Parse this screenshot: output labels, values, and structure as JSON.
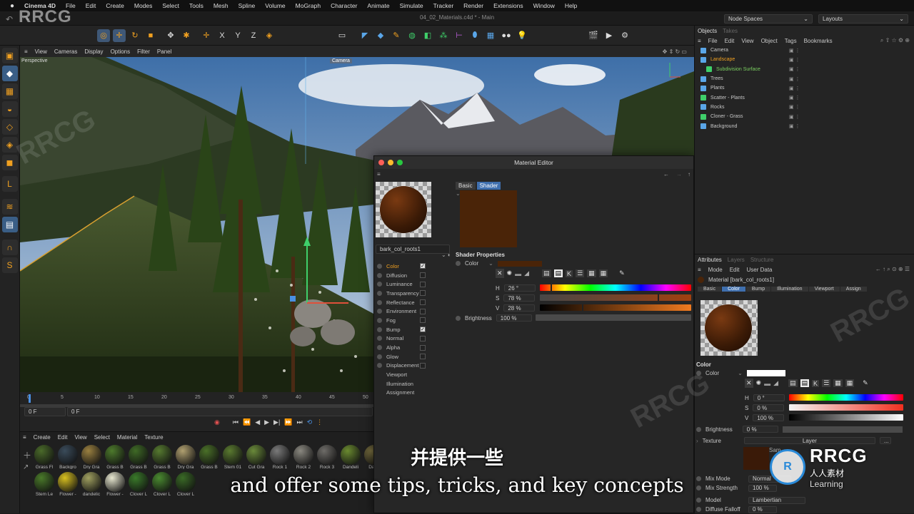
{
  "menubar": {
    "app": "Cinema 4D",
    "items": [
      "File",
      "Edit",
      "Create",
      "Modes",
      "Select",
      "Tools",
      "Mesh",
      "Spline",
      "Volume",
      "MoGraph",
      "Character",
      "Animate",
      "Simulate",
      "Tracker",
      "Render",
      "Extensions",
      "Window",
      "Help"
    ]
  },
  "watermark_top": "RRCG",
  "document_title": "04_02_Materials.c4d * - Main",
  "node_spaces": "Node Spaces",
  "layouts": "Layouts",
  "viewport": {
    "menu": [
      "View",
      "Cameras",
      "Display",
      "Options",
      "Filter",
      "Panel"
    ],
    "label": "Perspective",
    "camera_tag": "Camera"
  },
  "timeline": {
    "ticks": [
      "0",
      "5",
      "10",
      "15",
      "20",
      "25",
      "30",
      "35",
      "40",
      "45",
      "50"
    ],
    "start_frame": "0 F",
    "current_frame": "0 F"
  },
  "material_manager": {
    "menu": [
      "Create",
      "Edit",
      "View",
      "Select",
      "Material",
      "Texture"
    ],
    "row1": [
      {
        "label": "Grass Fl",
        "color": "#4a6a2a"
      },
      {
        "label": "Backgro",
        "color": "#3a4b5a"
      },
      {
        "label": "Dry Gra",
        "color": "#9a8040"
      },
      {
        "label": "Grass B",
        "color": "#4d7a2c"
      },
      {
        "label": "Grass B",
        "color": "#3f6a26"
      },
      {
        "label": "Grass B",
        "color": "#567a30"
      },
      {
        "label": "Dry Gra",
        "color": "#b0a070"
      },
      {
        "label": "Grass B",
        "color": "#4a7028"
      },
      {
        "label": "Stem 01",
        "color": "#5a7a30"
      },
      {
        "label": "Cut Gra",
        "color": "#6a8a3a"
      },
      {
        "label": "Rock 1",
        "color": "#7a7a7a"
      },
      {
        "label": "Rock 2",
        "color": "#8a8880"
      },
      {
        "label": "Rock 3",
        "color": "#6e6c68"
      },
      {
        "label": "Dandeli",
        "color": "#6a8a30"
      },
      {
        "label": "Dand",
        "color": "#7a7040"
      }
    ],
    "row2": [
      {
        "label": "Stem Le",
        "color": "#4a7a2a"
      },
      {
        "label": "Flower -",
        "color": "#d8c020"
      },
      {
        "label": "dandelic",
        "color": "#a0a060"
      },
      {
        "label": "Flower -",
        "color": "#e8e8d0"
      },
      {
        "label": "Clover L",
        "color": "#3a7a2a"
      },
      {
        "label": "Clover L",
        "color": "#4a8a30"
      },
      {
        "label": "Clover L",
        "color": "#3a6a26"
      }
    ]
  },
  "material_editor": {
    "title": "Material Editor",
    "material_name": "bark_col_roots1",
    "tabs": [
      "Basic",
      "Shader"
    ],
    "channels": [
      {
        "label": "Color",
        "checked": true,
        "active": true
      },
      {
        "label": "Diffusion",
        "checked": false
      },
      {
        "label": "Luminance",
        "checked": false
      },
      {
        "label": "Transparency",
        "checked": false
      },
      {
        "label": "Reflectance",
        "checked": false
      },
      {
        "label": "Environment",
        "checked": false
      },
      {
        "label": "Fog",
        "checked": false
      },
      {
        "label": "Bump",
        "checked": true
      },
      {
        "label": "Normal",
        "checked": false
      },
      {
        "label": "Alpha",
        "checked": false
      },
      {
        "label": "Glow",
        "checked": false
      },
      {
        "label": "Displacement",
        "checked": false
      },
      {
        "label": "Viewport"
      },
      {
        "label": "Illumination"
      },
      {
        "label": "Assignment"
      }
    ],
    "swatch_color": "#4a2408",
    "shader_properties": "Shader Properties",
    "color_label": "Color",
    "h_label": "H",
    "h_value": "26 °",
    "h_fraction": 0.07,
    "s_label": "S",
    "s_value": "78 %",
    "s_fraction": 0.78,
    "v_label": "V",
    "v_value": "28 %",
    "v_fraction": 0.28,
    "brightness_label": "Brightness",
    "brightness_value": "100 %"
  },
  "objects_panel": {
    "tabs": [
      "Objects",
      "Takes"
    ],
    "menu": [
      "File",
      "Edit",
      "View",
      "Object",
      "Tags",
      "Bookmarks"
    ],
    "items": [
      {
        "label": "Camera",
        "color": "#c8c8c8",
        "icon": "#5aa6e8",
        "indent": 0
      },
      {
        "label": "Landscape",
        "color": "#f0a020",
        "icon": "#5aa6e8",
        "indent": 0
      },
      {
        "label": "Subdivision Surface",
        "color": "#7bd060",
        "icon": "#3fcf6a",
        "indent": 1
      },
      {
        "label": "Trees",
        "color": "#c8c8c8",
        "icon": "#5aa6e8",
        "indent": 0
      },
      {
        "label": "Plants",
        "color": "#c8c8c8",
        "icon": "#5aa6e8",
        "indent": 0
      },
      {
        "label": "Scatter - Plants",
        "color": "#c8c8c8",
        "icon": "#3fcf6a",
        "indent": 0
      },
      {
        "label": "Rocks",
        "color": "#c8c8c8",
        "icon": "#5aa6e8",
        "indent": 0
      },
      {
        "label": "Cloner - Grass",
        "color": "#c8c8c8",
        "icon": "#3fcf6a",
        "indent": 0
      },
      {
        "label": "Background",
        "color": "#c8c8c8",
        "icon": "#5aa6e8",
        "indent": 0
      }
    ]
  },
  "attributes_panel": {
    "tabs": [
      "Attributes",
      "Layers",
      "Structure"
    ],
    "menu": [
      "Mode",
      "Edit",
      "User Data"
    ],
    "material_line": "Material [bark_col_roots1]",
    "subtabs": [
      "Basic",
      "Color",
      "Bump",
      "Illumination",
      "Viewport",
      "Assign"
    ],
    "section": "Color",
    "color_label": "Color",
    "h_label": "H",
    "h_value": "0 °",
    "s_label": "S",
    "s_value": "0 %",
    "v_label": "V",
    "v_value": "100 %",
    "brightness_label": "Brightness",
    "brightness_value": "0 %",
    "texture_label": "Texture",
    "layer_label": "Layer",
    "sample_label": "Sam",
    "mix_mode_label": "Mix Mode",
    "mix_mode_value": "Normal",
    "mix_strength_label": "Mix Strength",
    "mix_strength_value": "100 %",
    "model_label": "Model",
    "model_value": "Lambertian",
    "diffuse_falloff_label": "Diffuse Falloff",
    "diffuse_falloff_value": "0 %"
  },
  "subtitle_cn": "并提供一些",
  "subtitle_en": "and offer some tips, tricks, and key concepts",
  "logo": {
    "name": "RRCG",
    "tagline": "人人素材",
    "learning": "Learning"
  }
}
